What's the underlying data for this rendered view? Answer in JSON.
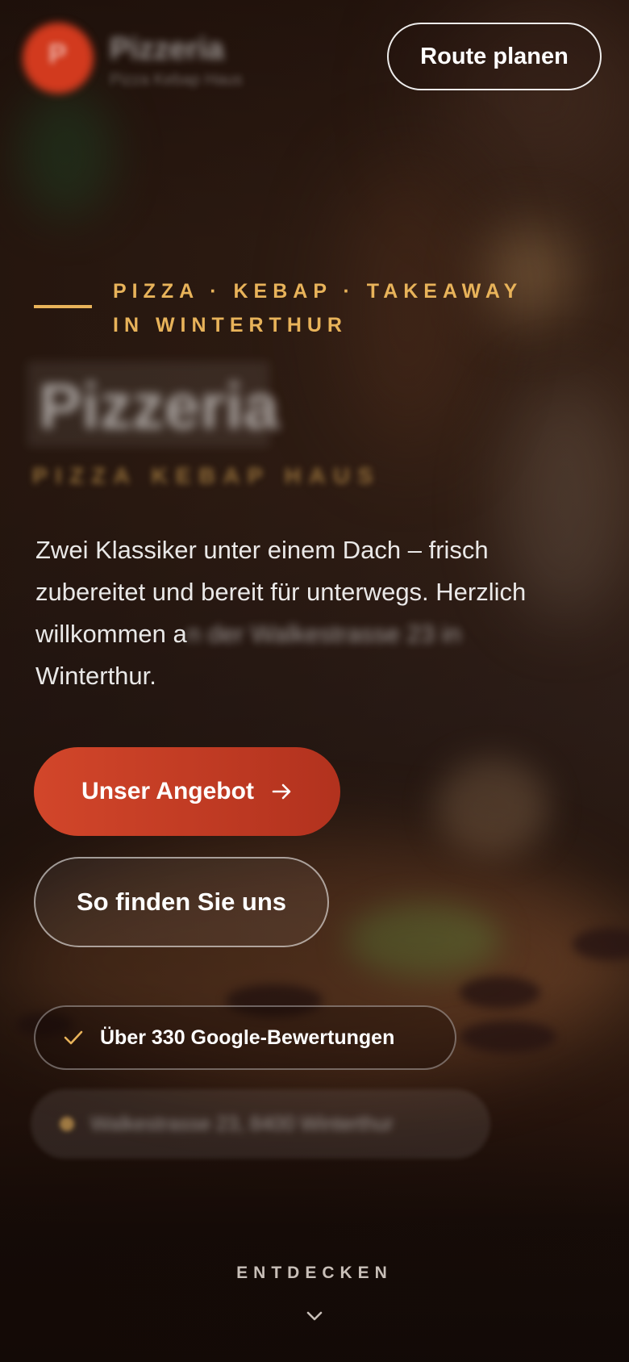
{
  "header": {
    "brand_initial": "P",
    "brand_name": "Pizzeria",
    "brand_tagline": "Pizza Kebap Haus",
    "route_button": "Route planen"
  },
  "hero": {
    "eyebrow": "PIZZA · KEBAP · TAKEAWAY IN WINTERTHUR",
    "title": "Pizzeria",
    "subtitle": "PIZZA KEBAP HAUS",
    "lead_visible": "Zwei Klassiker unter einem Dach – frisch zubereitet und bereit für unterwegs. Herzlich willkommen a",
    "lead_blurred": "n der Walkestrasse 23 in",
    "lead_end": "Winterthur.",
    "primary_button": "Unser Angebot",
    "secondary_button": "So finden Sie uns",
    "rating_badge": "Über 330 Google-Bewertungen",
    "address_badge": "Walkestrasse 23, 8400 Winterthur"
  },
  "footer": {
    "explore": "ENTDECKEN"
  },
  "icons": {
    "check": "check-icon",
    "arrow": "arrow-right-icon",
    "chevron": "chevron-down-icon",
    "pin": "pin-icon"
  },
  "colors": {
    "accent_gold": "#e8b35a",
    "primary_red": "#d2462a",
    "background": "#1a0f0a"
  }
}
